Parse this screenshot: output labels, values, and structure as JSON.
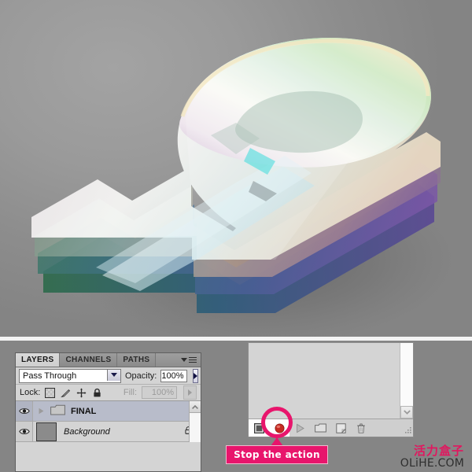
{
  "artwork": {
    "description": "abstract-3d-question-mark",
    "background_color": "#8f8f8f"
  },
  "layers_panel": {
    "tabs": [
      {
        "label": "LAYERS",
        "active": true
      },
      {
        "label": "CHANNELS",
        "active": false
      },
      {
        "label": "PATHS",
        "active": false
      }
    ],
    "menu_icon": "panel-menu-icon",
    "blend_mode": "Pass Through",
    "opacity_label": "Opacity:",
    "opacity_value": "100%",
    "lock_label": "Lock:",
    "lock_icons": [
      "lock-transparency-icon",
      "lock-paint-icon",
      "lock-position-icon",
      "lock-all-icon"
    ],
    "fill_label": "Fill:",
    "fill_value": "100%",
    "rows": [
      {
        "name": "FINAL",
        "type": "group",
        "visible": true,
        "selected": true,
        "expanded": false,
        "locked": false
      },
      {
        "name": "Background",
        "type": "layer",
        "visible": true,
        "selected": false,
        "expanded": false,
        "locked": true
      }
    ]
  },
  "actions_panel": {
    "toolbar_buttons": [
      {
        "name": "stop-button",
        "icon": "stop-square-icon",
        "highlighted": true
      },
      {
        "name": "record-button",
        "icon": "record-dot-icon",
        "highlighted": false
      },
      {
        "name": "play-button",
        "icon": "play-triangle-icon",
        "highlighted": false
      },
      {
        "name": "new-set-button",
        "icon": "folder-icon",
        "highlighted": false
      },
      {
        "name": "new-action-button",
        "icon": "new-page-icon",
        "highlighted": false
      },
      {
        "name": "delete-button",
        "icon": "trash-icon",
        "highlighted": false
      }
    ],
    "scroll_down_icon": "chevron-down-icon",
    "resize_grip": "resize-grip-icon"
  },
  "callout": {
    "text": "Stop the action",
    "color": "#e8156c"
  },
  "watermark": {
    "cn": "活力盒子",
    "en": "OLiHE.COM",
    "cn_color": "#e1175f",
    "en_color": "#2e2e2e"
  }
}
